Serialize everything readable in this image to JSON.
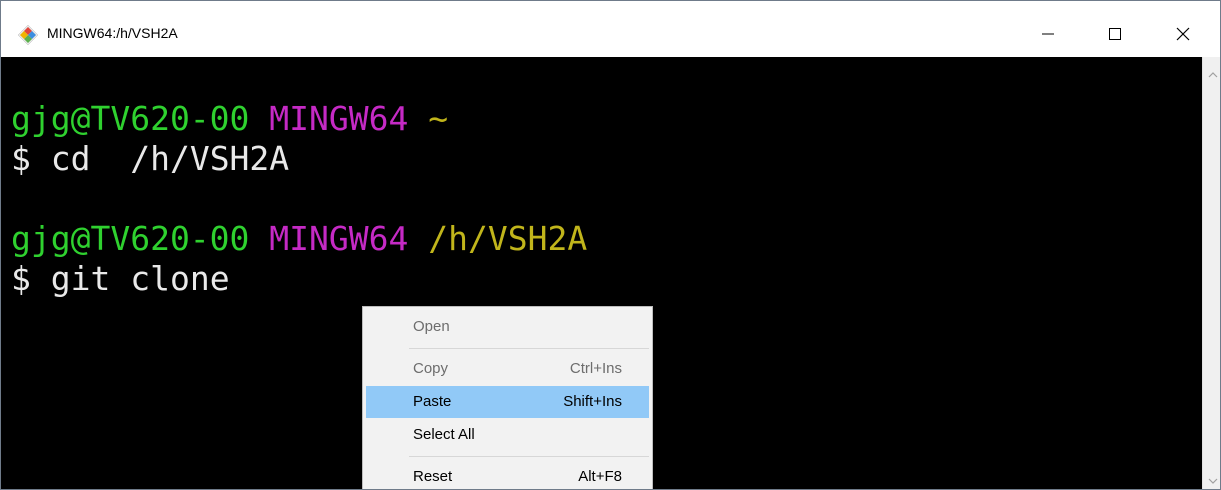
{
  "window": {
    "title": "MINGW64:/h/VSH2A",
    "icon": "git-logo-icon"
  },
  "controls": {
    "minimize_icon": "minimize-icon",
    "maximize_icon": "maximize-icon",
    "close_icon": "close-icon"
  },
  "terminal": {
    "lines": [
      {
        "user": "gjg@TV620-00",
        "shell": "MINGW64",
        "path": "~"
      },
      {
        "prompt": "$",
        "command": "cd  /h/VSH2A"
      },
      {
        "user": "gjg@TV620-00",
        "shell": "MINGW64",
        "path": "/h/VSH2A"
      },
      {
        "prompt": "$",
        "command": "git clone"
      }
    ],
    "colors": {
      "user": "#2fd12f",
      "shell": "#c52ac5",
      "path": "#c1b51b",
      "text": "#e9e9e9",
      "background": "#000000"
    }
  },
  "context_menu": {
    "items": [
      {
        "label": "Open",
        "shortcut": "",
        "enabled": false
      },
      {
        "label": "Copy",
        "shortcut": "Ctrl+Ins",
        "enabled": false
      },
      {
        "label": "Paste",
        "shortcut": "Shift+Ins",
        "enabled": true,
        "highlighted": true
      },
      {
        "label": "Select All",
        "shortcut": "",
        "enabled": true
      },
      {
        "label": "Reset",
        "shortcut": "Alt+F8",
        "enabled": true
      }
    ],
    "highlight_color": "#91c9f7"
  },
  "scrollbar": {
    "up_icon": "scroll-up-arrow-icon",
    "down_icon": "scroll-down-arrow-icon"
  }
}
